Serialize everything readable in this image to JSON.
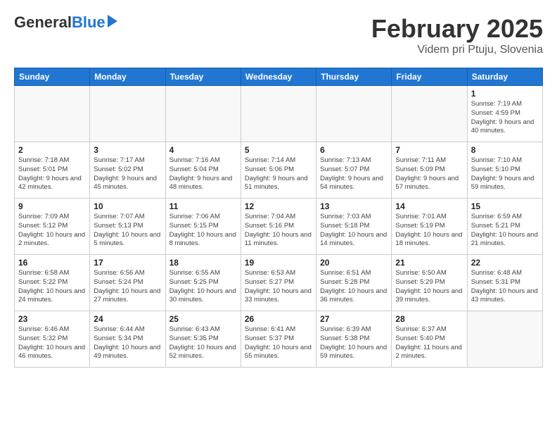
{
  "logo": {
    "general": "General",
    "blue": "Blue"
  },
  "title": "February 2025",
  "location": "Videm pri Ptuju, Slovenia",
  "days_of_week": [
    "Sunday",
    "Monday",
    "Tuesday",
    "Wednesday",
    "Thursday",
    "Friday",
    "Saturday"
  ],
  "weeks": [
    [
      {
        "day": "",
        "info": ""
      },
      {
        "day": "",
        "info": ""
      },
      {
        "day": "",
        "info": ""
      },
      {
        "day": "",
        "info": ""
      },
      {
        "day": "",
        "info": ""
      },
      {
        "day": "",
        "info": ""
      },
      {
        "day": "1",
        "info": "Sunrise: 7:19 AM\nSunset: 4:59 PM\nDaylight: 9 hours and 40 minutes."
      }
    ],
    [
      {
        "day": "2",
        "info": "Sunrise: 7:18 AM\nSunset: 5:01 PM\nDaylight: 9 hours and 42 minutes."
      },
      {
        "day": "3",
        "info": "Sunrise: 7:17 AM\nSunset: 5:02 PM\nDaylight: 9 hours and 45 minutes."
      },
      {
        "day": "4",
        "info": "Sunrise: 7:16 AM\nSunset: 5:04 PM\nDaylight: 9 hours and 48 minutes."
      },
      {
        "day": "5",
        "info": "Sunrise: 7:14 AM\nSunset: 5:06 PM\nDaylight: 9 hours and 51 minutes."
      },
      {
        "day": "6",
        "info": "Sunrise: 7:13 AM\nSunset: 5:07 PM\nDaylight: 9 hours and 54 minutes."
      },
      {
        "day": "7",
        "info": "Sunrise: 7:11 AM\nSunset: 5:09 PM\nDaylight: 9 hours and 57 minutes."
      },
      {
        "day": "8",
        "info": "Sunrise: 7:10 AM\nSunset: 5:10 PM\nDaylight: 9 hours and 59 minutes."
      }
    ],
    [
      {
        "day": "9",
        "info": "Sunrise: 7:09 AM\nSunset: 5:12 PM\nDaylight: 10 hours and 2 minutes."
      },
      {
        "day": "10",
        "info": "Sunrise: 7:07 AM\nSunset: 5:13 PM\nDaylight: 10 hours and 5 minutes."
      },
      {
        "day": "11",
        "info": "Sunrise: 7:06 AM\nSunset: 5:15 PM\nDaylight: 10 hours and 8 minutes."
      },
      {
        "day": "12",
        "info": "Sunrise: 7:04 AM\nSunset: 5:16 PM\nDaylight: 10 hours and 11 minutes."
      },
      {
        "day": "13",
        "info": "Sunrise: 7:03 AM\nSunset: 5:18 PM\nDaylight: 10 hours and 14 minutes."
      },
      {
        "day": "14",
        "info": "Sunrise: 7:01 AM\nSunset: 5:19 PM\nDaylight: 10 hours and 18 minutes."
      },
      {
        "day": "15",
        "info": "Sunrise: 6:59 AM\nSunset: 5:21 PM\nDaylight: 10 hours and 21 minutes."
      }
    ],
    [
      {
        "day": "16",
        "info": "Sunrise: 6:58 AM\nSunset: 5:22 PM\nDaylight: 10 hours and 24 minutes."
      },
      {
        "day": "17",
        "info": "Sunrise: 6:56 AM\nSunset: 5:24 PM\nDaylight: 10 hours and 27 minutes."
      },
      {
        "day": "18",
        "info": "Sunrise: 6:55 AM\nSunset: 5:25 PM\nDaylight: 10 hours and 30 minutes."
      },
      {
        "day": "19",
        "info": "Sunrise: 6:53 AM\nSunset: 5:27 PM\nDaylight: 10 hours and 33 minutes."
      },
      {
        "day": "20",
        "info": "Sunrise: 6:51 AM\nSunset: 5:28 PM\nDaylight: 10 hours and 36 minutes."
      },
      {
        "day": "21",
        "info": "Sunrise: 6:50 AM\nSunset: 5:29 PM\nDaylight: 10 hours and 39 minutes."
      },
      {
        "day": "22",
        "info": "Sunrise: 6:48 AM\nSunset: 5:31 PM\nDaylight: 10 hours and 43 minutes."
      }
    ],
    [
      {
        "day": "23",
        "info": "Sunrise: 6:46 AM\nSunset: 5:32 PM\nDaylight: 10 hours and 46 minutes."
      },
      {
        "day": "24",
        "info": "Sunrise: 6:44 AM\nSunset: 5:34 PM\nDaylight: 10 hours and 49 minutes."
      },
      {
        "day": "25",
        "info": "Sunrise: 6:43 AM\nSunset: 5:35 PM\nDaylight: 10 hours and 52 minutes."
      },
      {
        "day": "26",
        "info": "Sunrise: 6:41 AM\nSunset: 5:37 PM\nDaylight: 10 hours and 55 minutes."
      },
      {
        "day": "27",
        "info": "Sunrise: 6:39 AM\nSunset: 5:38 PM\nDaylight: 10 hours and 59 minutes."
      },
      {
        "day": "28",
        "info": "Sunrise: 6:37 AM\nSunset: 5:40 PM\nDaylight: 11 hours and 2 minutes."
      },
      {
        "day": "",
        "info": ""
      }
    ]
  ]
}
